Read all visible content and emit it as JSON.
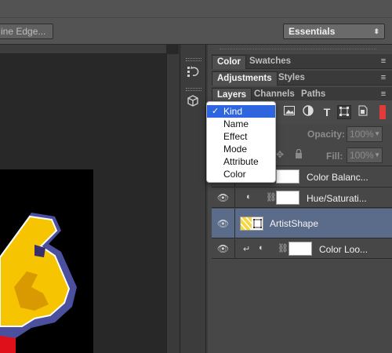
{
  "options_bar": {
    "refine_edge_label": "ine Edge...",
    "workspace_label": "Essentials",
    "workspace_arrow": "⬍"
  },
  "dock": {
    "history_icon": "history-icon",
    "three_d_icon": "3d-cube-icon"
  },
  "panels": {
    "color_group": {
      "tabs": [
        "Color",
        "Swatches"
      ]
    },
    "adjustments_group": {
      "tabs": [
        "Adjustments",
        "Styles"
      ]
    },
    "layers_group": {
      "tabs": [
        "Layers",
        "Channels",
        "Paths"
      ]
    },
    "menu_glyph": "≡"
  },
  "layers_panel": {
    "opacity_label": "Opacity:",
    "opacity_value": "100%",
    "fill_label": "Fill:",
    "fill_value": "100%",
    "layers": [
      {
        "name": "Color Balanc...",
        "type": "adjustment",
        "visible": true
      },
      {
        "name": "Hue/Saturati...",
        "type": "adjustment",
        "visible": true
      },
      {
        "name": "ArtistShape",
        "type": "shape",
        "visible": true,
        "selected": true
      },
      {
        "name": "Color Loo...",
        "type": "adjustment",
        "visible": true,
        "clipped": true
      }
    ]
  },
  "filter_menu": {
    "items": [
      {
        "label": "Kind",
        "checked": true
      },
      {
        "label": "Name"
      },
      {
        "label": "Effect"
      },
      {
        "label": "Mode"
      },
      {
        "label": "Attribute"
      },
      {
        "label": "Color"
      }
    ],
    "check_glyph": "✓"
  },
  "colors": {
    "selection_blue": "#2f66e0",
    "selected_layer": "#5b6c8a",
    "filter_toggle_red": "#e13b3b",
    "canvas_yellow": "#f6c400",
    "canvas_red": "#e0101a"
  }
}
